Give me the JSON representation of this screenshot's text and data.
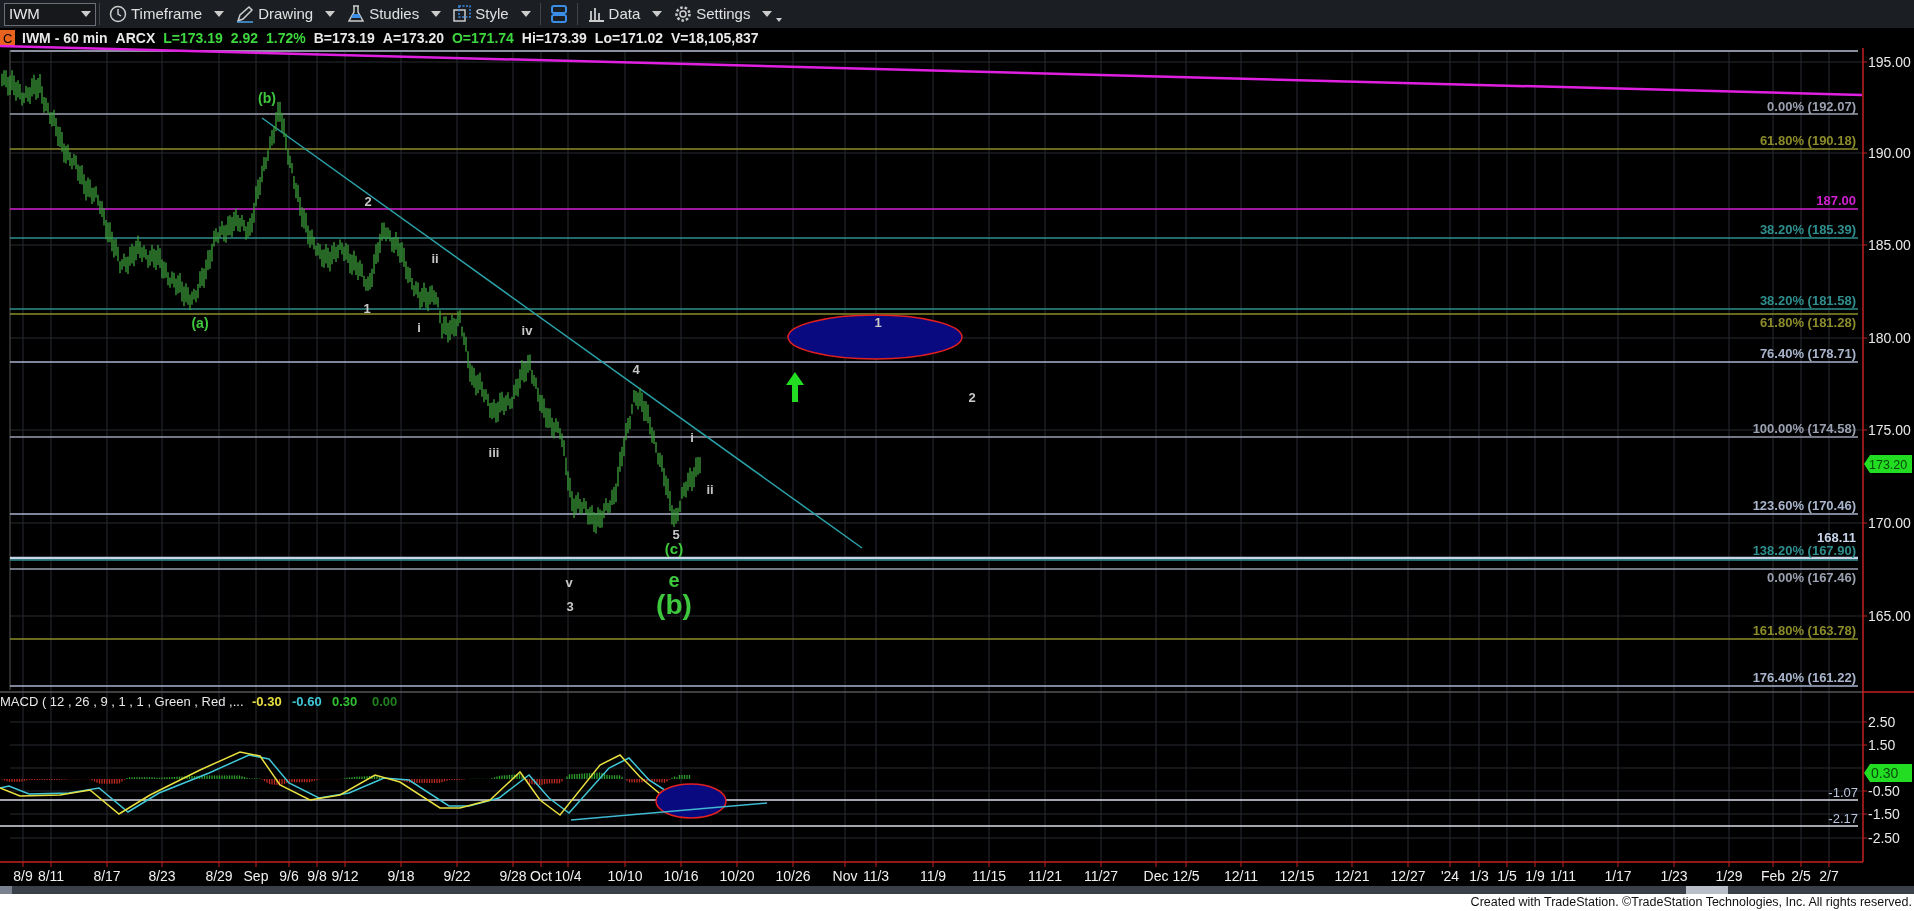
{
  "toolbar": {
    "symbol": "IWM",
    "buttons": [
      {
        "kind": "menu",
        "label": "Timeframe"
      },
      {
        "kind": "menu",
        "label": "Drawing"
      },
      {
        "kind": "menu",
        "label": "Studies"
      },
      {
        "kind": "menu",
        "label": "Style"
      },
      {
        "kind": "icon"
      },
      {
        "kind": "menu",
        "label": "Data"
      },
      {
        "kind": "menu",
        "label": "Settings"
      }
    ]
  },
  "symbol_bar": {
    "badge": "C",
    "fields": [
      {
        "text": "IWM - 60 min",
        "color": "#e8e8e8"
      },
      {
        "text": "ARCX",
        "color": "#e8e8e8"
      },
      {
        "text": "L=173.19",
        "color": "#3ed83e"
      },
      {
        "text": "2.92",
        "color": "#3ed83e"
      },
      {
        "text": "1.72%",
        "color": "#3ed83e"
      },
      {
        "text": "B=173.19",
        "color": "#e8e8e8"
      },
      {
        "text": "A=173.20",
        "color": "#e8e8e8"
      },
      {
        "text": "O=171.74",
        "color": "#3ed83e"
      },
      {
        "text": "Hi=173.39",
        "color": "#e8e8e8"
      },
      {
        "text": "Lo=171.02",
        "color": "#e8e8e8"
      },
      {
        "text": "V=18,105,837",
        "color": "#e8e8e8"
      }
    ]
  },
  "price_chart": {
    "axis_labels": [
      "195.00",
      "190.00",
      "185.00",
      "180.00",
      "175.00",
      "170.00",
      "165.00"
    ],
    "last_price": "173.20",
    "levels": [
      {
        "label": "0.00% (192.07)",
        "color": "#9aa0b0"
      },
      {
        "label": "61.80% (190.18)",
        "color": "#8c8c2a"
      },
      {
        "label": "187.00",
        "color": "#d020d0"
      },
      {
        "label": "38.20% (185.39)",
        "color": "#2f8f8f"
      },
      {
        "label": "38.20% (181.58)",
        "color": "#2f8f8f"
      },
      {
        "label": "61.80% (181.28)",
        "color": "#8c8c2a"
      },
      {
        "label": "76.40% (178.71)",
        "color": "#a8b4cc"
      },
      {
        "label": "100.00% (174.58)",
        "color": "#9aa0b0"
      },
      {
        "label": "123.60% (170.46)",
        "color": "#a8b4cc"
      },
      {
        "label": "168.11",
        "color": "#c8d4e8"
      },
      {
        "label": "138.20% (167.90)",
        "color": "#2f8f8f"
      },
      {
        "label": "0.00% (167.46)",
        "color": "#9aa0b0"
      },
      {
        "label": "161.80% (163.78)",
        "color": "#8c8c2a"
      },
      {
        "label": "176.40% (161.22)",
        "color": "#a8b4cc"
      }
    ],
    "wave_labels": [
      {
        "text": "(b)",
        "color": "#3ec83e"
      },
      {
        "text": "(a)",
        "color": "#3ec83e"
      },
      {
        "text": "2",
        "color": "#c8c8c8"
      },
      {
        "text": "1",
        "color": "#c8c8c8"
      },
      {
        "text": "ii",
        "color": "#c8c8c8"
      },
      {
        "text": "i",
        "color": "#c8c8c8"
      },
      {
        "text": "iv",
        "color": "#c8c8c8"
      },
      {
        "text": "iii",
        "color": "#c8c8c8"
      },
      {
        "text": "v",
        "color": "#c8c8c8"
      },
      {
        "text": "3",
        "color": "#c8c8c8"
      },
      {
        "text": "4",
        "color": "#c8c8c8"
      },
      {
        "text": "5",
        "color": "#c8c8c8"
      },
      {
        "text": "(c)",
        "color": "#3ec83e"
      },
      {
        "text": "e",
        "color": "#3ec83e"
      },
      {
        "text": "(b)",
        "color": "#3ec83e"
      },
      {
        "text": "i",
        "color": "#c8c8c8"
      },
      {
        "text": "ii",
        "color": "#c8c8c8"
      },
      {
        "text": "1",
        "color": "#c8c8c8"
      },
      {
        "text": "2",
        "color": "#c8c8c8"
      }
    ]
  },
  "macd": {
    "title": "MACD ( 12 , 26 , 9 , 1 , 1 , Green , Red ,...",
    "values": [
      {
        "text": "-0.30",
        "color": "#e8e040"
      },
      {
        "text": "-0.60",
        "color": "#40c8d8"
      },
      {
        "text": "0.30",
        "color": "#30c030"
      },
      {
        "text": "0.00",
        "color": "#208020"
      }
    ],
    "axis_labels": [
      "2.50",
      "1.50",
      "-0.50",
      "-1.50",
      "-2.50"
    ],
    "level_labels": [
      "-1.07",
      "-2.17"
    ],
    "last_value": "0.30"
  },
  "date_axis": [
    "8/9",
    "8/11",
    "8/17",
    "8/23",
    "8/29",
    "Sep",
    "9/6",
    "9/8",
    "9/12",
    "9/18",
    "9/22",
    "9/28",
    "Oct",
    "10/4",
    "10/10",
    "10/16",
    "10/20",
    "10/26",
    "Nov",
    "11/3",
    "11/9",
    "11/15",
    "11/21",
    "11/27",
    "Dec",
    "12/5",
    "12/11",
    "12/15",
    "12/21",
    "12/27",
    "'24",
    "1/3",
    "1/5",
    "1/9",
    "1/11",
    "1/17",
    "1/23",
    "1/29",
    "Feb",
    "2/5",
    "2/7"
  ],
  "credit": "Created with TradeStation. ©TradeStation Technologies, Inc. All rights reserved."
}
